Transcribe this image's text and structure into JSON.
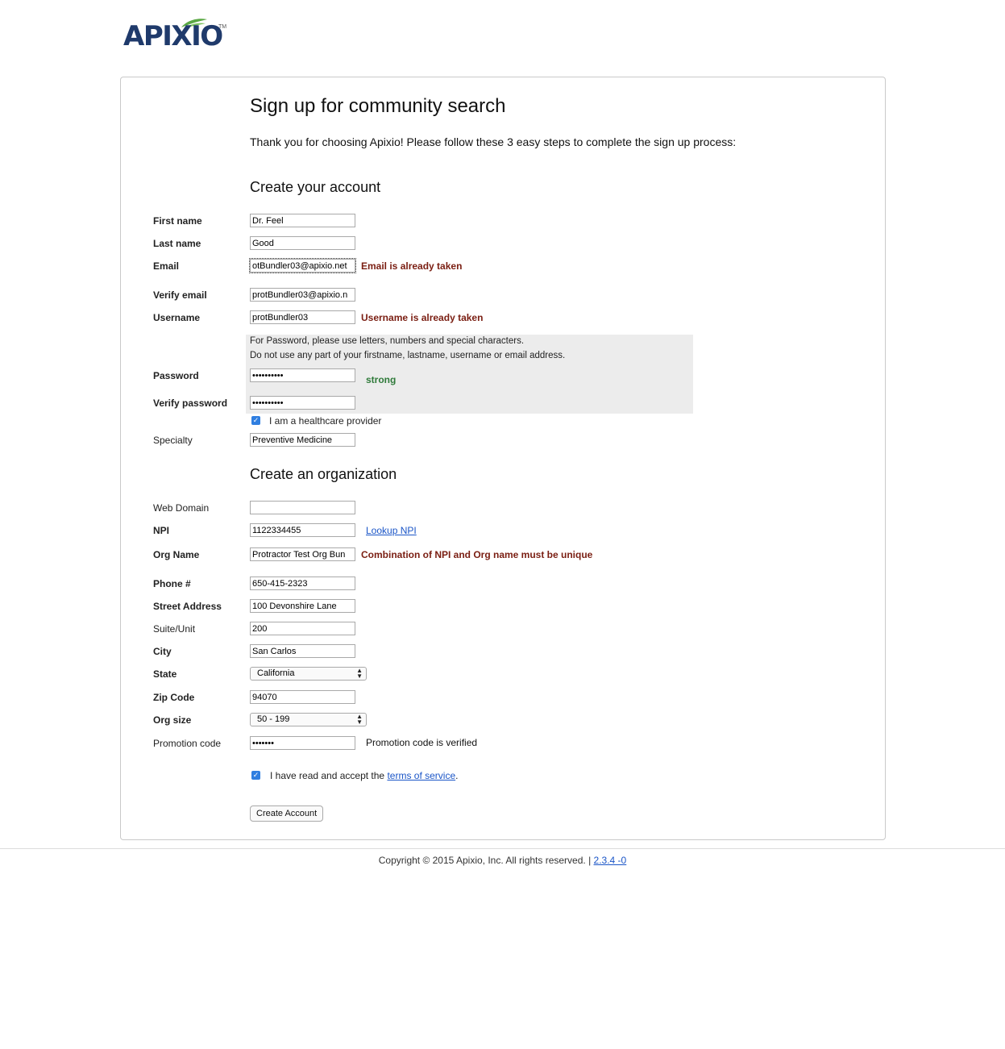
{
  "brand": {
    "logo_text": "APIXIO",
    "tm": "TM",
    "accent_green": "#5aa843",
    "navy": "#1f3a6b"
  },
  "page": {
    "title": "Sign up for community search",
    "intro": "Thank you for choosing Apixio! Please follow these 3 easy steps to complete the sign up process:"
  },
  "account": {
    "heading": "Create your account",
    "first_name": {
      "label": "First name",
      "value": "Dr. Feel"
    },
    "last_name": {
      "label": "Last name",
      "value": "Good"
    },
    "email": {
      "label": "Email",
      "value": "otBundler03@apixio.net",
      "error": "Email is already taken"
    },
    "verify_email": {
      "label": "Verify email",
      "value": "protBundler03@apixio.n"
    },
    "username": {
      "label": "Username",
      "value": "protBundler03",
      "error": "Username is already taken"
    },
    "password_hint_1": "For Password, please use letters, numbers and special characters.",
    "password_hint_2": "Do not use any part of your firstname, lastname, username or email address.",
    "password": {
      "label": "Password",
      "value": "••••••••••",
      "strength": "strong"
    },
    "verify_password": {
      "label": "Verify password",
      "value": "••••••••••"
    },
    "healthcare_provider": {
      "label": "I am a healthcare provider",
      "checked": true
    },
    "specialty": {
      "label": "Specialty",
      "value": "Preventive Medicine"
    }
  },
  "organization": {
    "heading": "Create an organization",
    "web_domain": {
      "label": "Web Domain",
      "value": ""
    },
    "npi": {
      "label": "NPI",
      "value": "1122334455",
      "lookup_link": "Lookup NPI"
    },
    "org_name": {
      "label": "Org Name",
      "value": "Protractor Test Org Bun",
      "error": "Combination of NPI and Org name must be unique"
    },
    "phone": {
      "label": "Phone #",
      "value": "650-415-2323"
    },
    "street": {
      "label": "Street Address",
      "value": "100 Devonshire Lane"
    },
    "suite": {
      "label": "Suite/Unit",
      "value": "200"
    },
    "city": {
      "label": "City",
      "value": "San Carlos"
    },
    "state": {
      "label": "State",
      "value": "California"
    },
    "zip": {
      "label": "Zip Code",
      "value": "94070"
    },
    "org_size": {
      "label": "Org size",
      "value": "50 - 199"
    },
    "promo": {
      "label": "Promotion code",
      "value": "•••••••",
      "status": "Promotion code is verified"
    }
  },
  "terms": {
    "prefix": "I have read and accept the ",
    "link": "terms of service",
    "suffix": ".",
    "checked": true
  },
  "submit_label": "Create Account",
  "footer": {
    "copyright": "Copyright © 2015 Apixio, Inc. All rights reserved. | ",
    "version": "2.3.4 -0"
  }
}
